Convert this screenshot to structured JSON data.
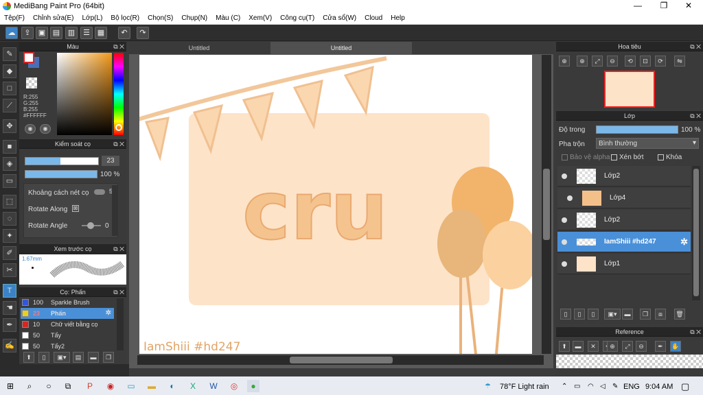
{
  "window": {
    "title": "MediBang Paint Pro (64bit)",
    "min": "—",
    "max": "❐",
    "close": "✕"
  },
  "menu": [
    "Tệp(F)",
    "Chỉnh sửa(E)",
    "Lớp(L)",
    "Bộ lọc(R)",
    "Chọn(S)",
    "Chụp(N)",
    "Màu (C)",
    "Xem(V)",
    "Công cụ(T)",
    "Cửa sổ(W)",
    "Cloud",
    "Help"
  ],
  "color_panel": {
    "title": "Màu",
    "r": "R:255",
    "g": "G:255",
    "b": "B:255",
    "hex": "#FFFFFF",
    "primary": "#ffffff",
    "secondary": "#4a6fb5"
  },
  "brush_control": {
    "title": "Kiểm soát cọ",
    "size": "23",
    "opacity": "100 %",
    "spacing_label": "Khoảng cách nét cọ",
    "spacing_value": "5",
    "rotate_along_label": "Rotate Along",
    "rotate_angle_label": "Rotate Angle",
    "rotate_angle_value": "0"
  },
  "brush_preview": {
    "title": "Xem trước cọ",
    "size": "1.67mm"
  },
  "brush_list": {
    "title": "Cọ: Phấn",
    "items": [
      {
        "num": "100",
        "name": "Sparkle Brush",
        "color": "#3355dd"
      },
      {
        "num": "23",
        "name": "Phấn",
        "color": "#e8d21a"
      },
      {
        "num": "10",
        "name": "Chữ viết bằng cọ",
        "color": "#dd2222"
      },
      {
        "num": "50",
        "name": "Tẩy",
        "color": "#ffffff"
      },
      {
        "num": "50",
        "name": "Tẩy2",
        "color": "#ffffff"
      }
    ]
  },
  "tabs": [
    "Untitled",
    "Untitled"
  ],
  "canvas": {
    "main_text": "cru",
    "watermark": "IamShiii #hd247"
  },
  "navigator": {
    "title": "Hoa tiêu"
  },
  "layer_panel": {
    "title": "Lớp",
    "opacity_label": "Độ trong",
    "opacity_value": "100 %",
    "blend_label": "Pha trộn",
    "blend_value": "Bình thường",
    "protect_alpha": "Bảo vệ alpha",
    "clip": "Xén bớt",
    "lock": "Khóa",
    "layers": [
      {
        "name": "Lớp2"
      },
      {
        "name": "Lớp4"
      },
      {
        "name": "Lớp2"
      },
      {
        "name": "IamShiii #hd247"
      },
      {
        "name": "Lớp1"
      }
    ]
  },
  "reference": {
    "title": "Reference"
  },
  "taskbar": {
    "weather": "78°F  Light rain",
    "lang": "ENG",
    "time": "9:04 AM"
  }
}
